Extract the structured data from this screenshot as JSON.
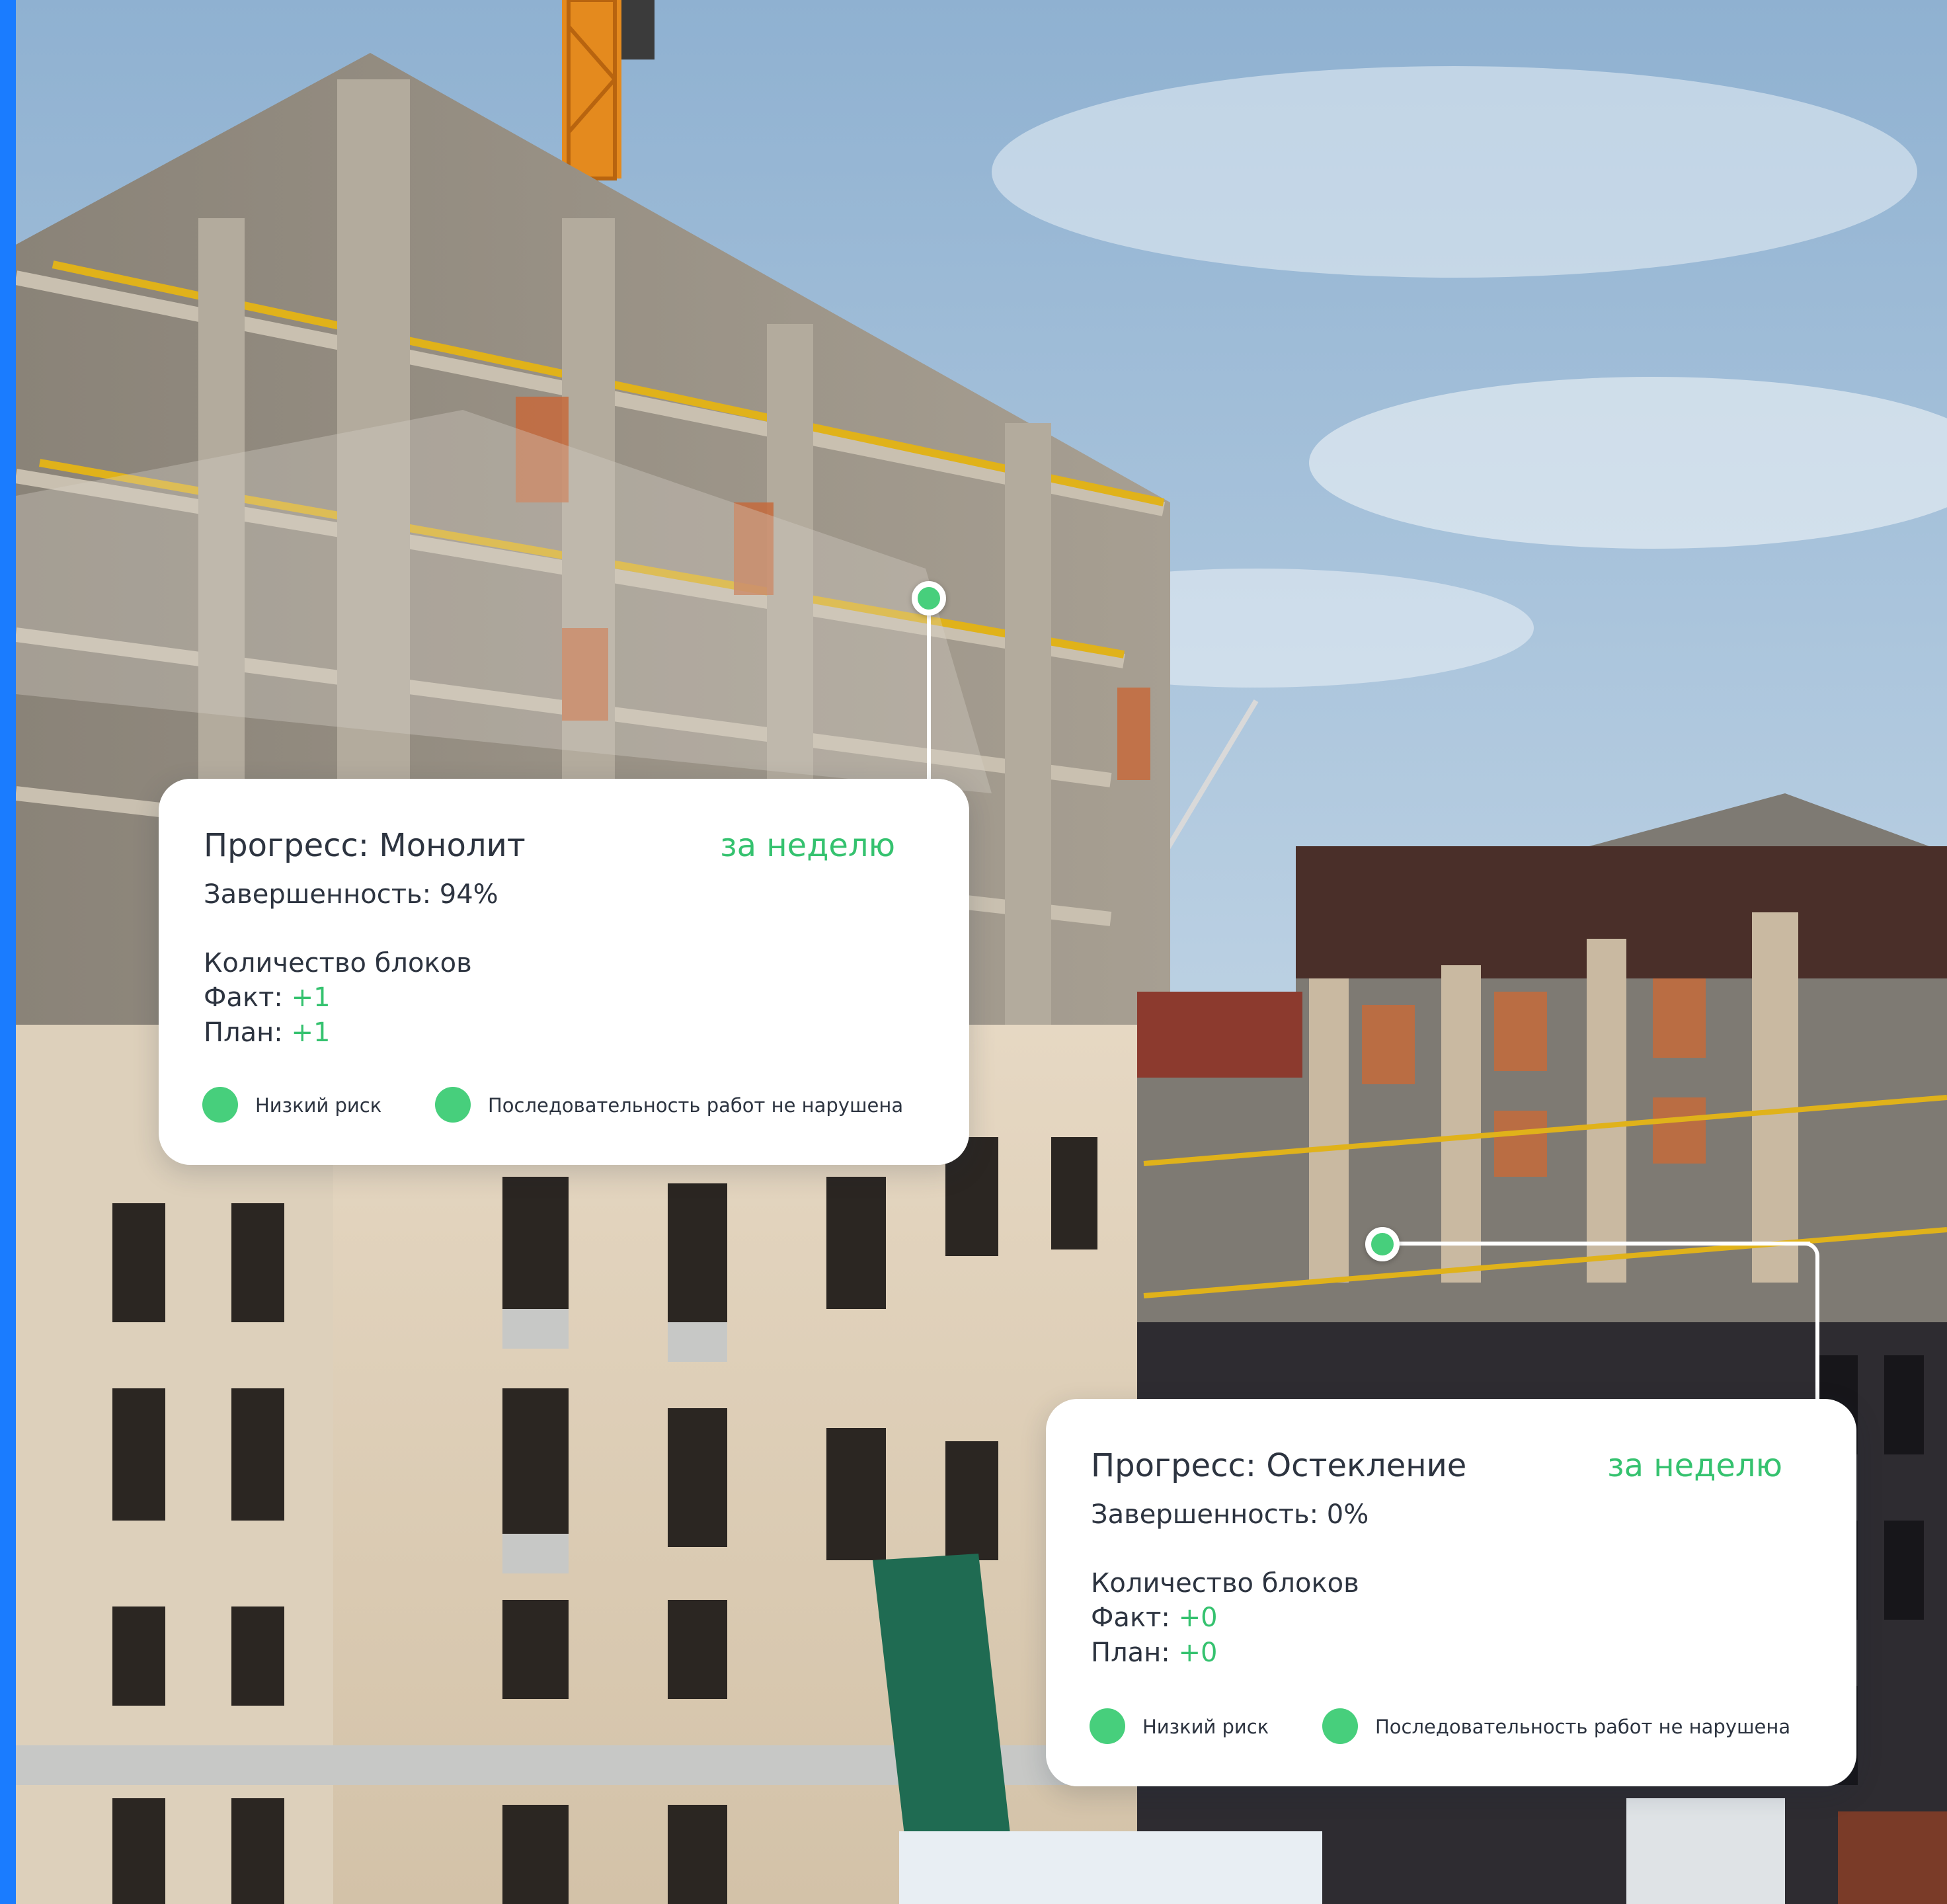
{
  "cards": [
    {
      "title": "Прогресс: Монолит",
      "period": "за неделю",
      "completion": "Завершенность: 94%",
      "blocks_title": "Количество блоков",
      "fact_label": "Факт: ",
      "fact_value": "+1",
      "plan_label": "План: ",
      "plan_value": "+1",
      "badges": [
        {
          "label": "Низкий риск",
          "color": "#47cf7c"
        },
        {
          "label": "Последовательность работ не нарушена",
          "color": "#47cf7c"
        }
      ]
    },
    {
      "title": "Прогресс: Остекление",
      "period": "за неделю",
      "completion": "Завершенность: 0%",
      "blocks_title": "Количество блоков",
      "fact_label": "Факт: ",
      "fact_value": "+0",
      "plan_label": "План: ",
      "plan_value": "+0",
      "badges": [
        {
          "label": "Низкий риск",
          "color": "#47cf7c"
        },
        {
          "label": "Последовательность работ не нарушена",
          "color": "#47cf7c"
        }
      ]
    }
  ],
  "colors": {
    "accent_green": "#35c26f",
    "edge_bar_blue": "#1a7cff",
    "card_text": "#2d3440"
  }
}
